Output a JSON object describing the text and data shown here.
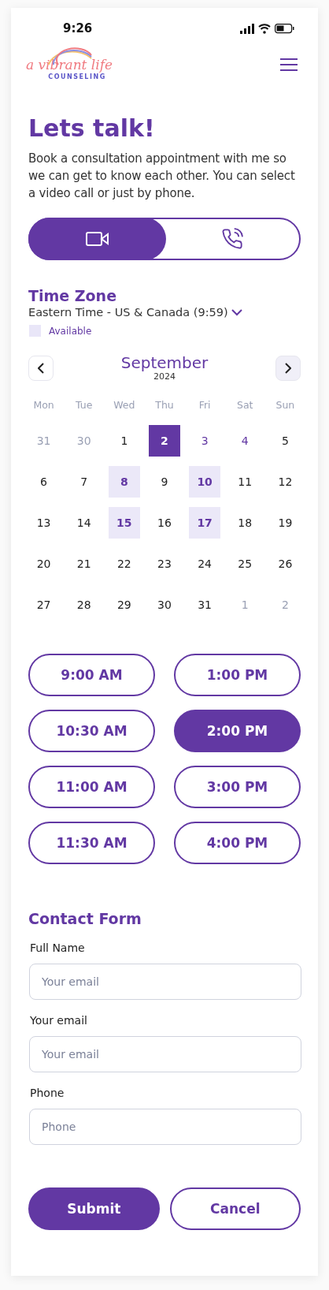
{
  "status_bar": {
    "time": "9:26"
  },
  "logo": {
    "script": "a vibrant life",
    "subtitle": "COUNSELING"
  },
  "title": "Lets talk!",
  "intro": "Book a consultation appointment with me so we can get to know each other. You can select a video call or just by phone.",
  "call_modes": [
    {
      "kind": "video",
      "selected": true
    },
    {
      "kind": "phone",
      "selected": false
    }
  ],
  "time_zone": {
    "heading": "Time Zone",
    "value": "Eastern Time - US & Canada (9:59)",
    "legend": "Available"
  },
  "calendar": {
    "month": "September",
    "year": "2024",
    "weekdays": [
      "Mon",
      "Tue",
      "Wed",
      "Thu",
      "Fri",
      "Sat",
      "Sun"
    ],
    "days": [
      {
        "label": "31",
        "other_month": true,
        "available": false,
        "marked": false,
        "selected": false
      },
      {
        "label": "30",
        "other_month": true,
        "available": false,
        "marked": false,
        "selected": false
      },
      {
        "label": "1",
        "other_month": false,
        "available": false,
        "marked": false,
        "selected": false
      },
      {
        "label": "2",
        "other_month": false,
        "available": false,
        "marked": false,
        "selected": true
      },
      {
        "label": "3",
        "other_month": false,
        "available": false,
        "marked": true,
        "selected": false
      },
      {
        "label": "4",
        "other_month": false,
        "available": false,
        "marked": true,
        "selected": false
      },
      {
        "label": "5",
        "other_month": false,
        "available": false,
        "marked": false,
        "selected": false
      },
      {
        "label": "6",
        "other_month": false,
        "available": false,
        "marked": false,
        "selected": false
      },
      {
        "label": "7",
        "other_month": false,
        "available": false,
        "marked": false,
        "selected": false
      },
      {
        "label": "8",
        "other_month": false,
        "available": true,
        "marked": false,
        "selected": false
      },
      {
        "label": "9",
        "other_month": false,
        "available": false,
        "marked": false,
        "selected": false
      },
      {
        "label": "10",
        "other_month": false,
        "available": true,
        "marked": false,
        "selected": false
      },
      {
        "label": "11",
        "other_month": false,
        "available": false,
        "marked": false,
        "selected": false
      },
      {
        "label": "12",
        "other_month": false,
        "available": false,
        "marked": false,
        "selected": false
      },
      {
        "label": "13",
        "other_month": false,
        "available": false,
        "marked": false,
        "selected": false
      },
      {
        "label": "14",
        "other_month": false,
        "available": false,
        "marked": false,
        "selected": false
      },
      {
        "label": "15",
        "other_month": false,
        "available": true,
        "marked": false,
        "selected": false
      },
      {
        "label": "16",
        "other_month": false,
        "available": false,
        "marked": false,
        "selected": false
      },
      {
        "label": "17",
        "other_month": false,
        "available": true,
        "marked": false,
        "selected": false
      },
      {
        "label": "18",
        "other_month": false,
        "available": false,
        "marked": false,
        "selected": false
      },
      {
        "label": "19",
        "other_month": false,
        "available": false,
        "marked": false,
        "selected": false
      },
      {
        "label": "20",
        "other_month": false,
        "available": false,
        "marked": false,
        "selected": false
      },
      {
        "label": "21",
        "other_month": false,
        "available": false,
        "marked": false,
        "selected": false
      },
      {
        "label": "22",
        "other_month": false,
        "available": false,
        "marked": false,
        "selected": false
      },
      {
        "label": "23",
        "other_month": false,
        "available": false,
        "marked": false,
        "selected": false
      },
      {
        "label": "24",
        "other_month": false,
        "available": false,
        "marked": false,
        "selected": false
      },
      {
        "label": "25",
        "other_month": false,
        "available": false,
        "marked": false,
        "selected": false
      },
      {
        "label": "26",
        "other_month": false,
        "available": false,
        "marked": false,
        "selected": false
      },
      {
        "label": "27",
        "other_month": false,
        "available": false,
        "marked": false,
        "selected": false
      },
      {
        "label": "28",
        "other_month": false,
        "available": false,
        "marked": false,
        "selected": false
      },
      {
        "label": "29",
        "other_month": false,
        "available": false,
        "marked": false,
        "selected": false
      },
      {
        "label": "30",
        "other_month": false,
        "available": false,
        "marked": false,
        "selected": false
      },
      {
        "label": "31",
        "other_month": false,
        "available": false,
        "marked": false,
        "selected": false
      },
      {
        "label": "1",
        "other_month": true,
        "available": false,
        "marked": false,
        "selected": false
      },
      {
        "label": "2",
        "other_month": true,
        "available": false,
        "marked": false,
        "selected": false
      }
    ]
  },
  "time_slots": [
    {
      "label": "9:00 AM",
      "selected": false
    },
    {
      "label": "1:00 PM",
      "selected": false
    },
    {
      "label": "10:30 AM",
      "selected": false
    },
    {
      "label": "2:00 PM",
      "selected": true
    },
    {
      "label": "11:00 AM",
      "selected": false
    },
    {
      "label": "3:00 PM",
      "selected": false
    },
    {
      "label": "11:30 AM",
      "selected": false
    },
    {
      "label": "4:00 PM",
      "selected": false
    }
  ],
  "contact_form": {
    "heading": "Contact Form",
    "fields": [
      {
        "label": "Full Name",
        "placeholder": "Your email"
      },
      {
        "label": "Your email",
        "placeholder": "Your email"
      },
      {
        "label": "Phone",
        "placeholder": "Phone"
      }
    ]
  },
  "buttons": [
    {
      "label": "Submit",
      "kind": "primary"
    },
    {
      "label": "Cancel",
      "kind": "secondary"
    }
  ]
}
